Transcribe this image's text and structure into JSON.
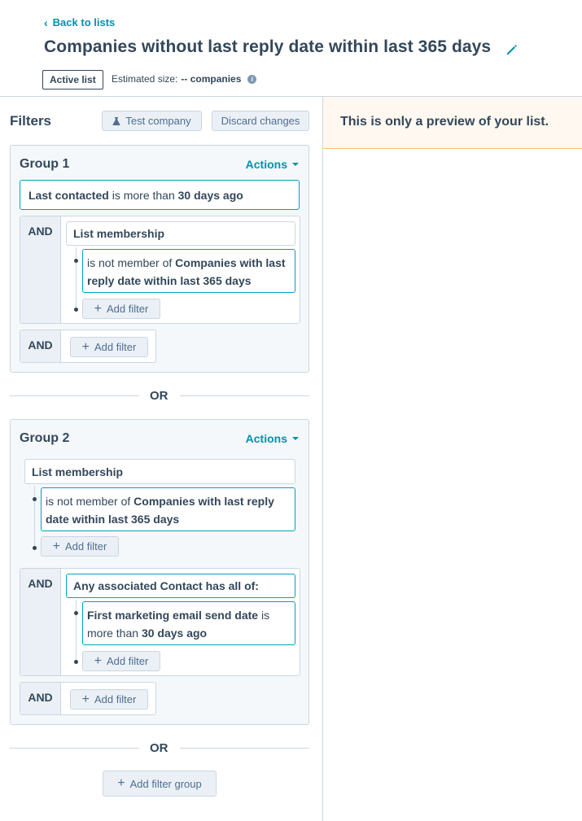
{
  "header": {
    "back_label": "Back to lists",
    "title": "Companies without last reply date within last 365 days",
    "status_badge": "Active list",
    "estimated_size_label": "Estimated size:",
    "estimated_size_value": "-- companies"
  },
  "filters": {
    "title": "Filters",
    "test_button": "Test company",
    "discard_button": "Discard changes"
  },
  "preview": {
    "banner_text": "This is only a preview of your list."
  },
  "group1": {
    "title": "Group 1",
    "actions_label": "Actions",
    "filter1": {
      "prop": "Last contacted",
      "op": "is more than",
      "value": "30 days ago"
    },
    "and_label": "AND",
    "membership_title": "List membership",
    "membership_op": "is not member of",
    "membership_value": "Companies with last reply date within last 365 days",
    "add_filter_label": "Add filter",
    "and_label_2": "AND",
    "add_filter_label_2": "Add filter"
  },
  "or_label_1": "OR",
  "group2": {
    "title": "Group 2",
    "actions_label": "Actions",
    "membership_title": "List membership",
    "membership_op": "is not member of",
    "membership_value": "Companies with last reply date within last 365 days",
    "add_filter_label": "Add filter",
    "and_label": "AND",
    "assoc_title": "Any associated Contact has all of:",
    "assoc_prop": "First marketing email send date",
    "assoc_op": "is more than",
    "assoc_value": "30 days ago",
    "add_filter_label_2": "Add filter",
    "and_label_2": "AND",
    "add_filter_label_3": "Add filter"
  },
  "or_label_2": "OR",
  "add_group_label": "Add filter group",
  "colors": {
    "accent": "#0091ae",
    "text": "#33475b",
    "border": "#cbd6e2",
    "highlight_border": "#00a4bd"
  }
}
